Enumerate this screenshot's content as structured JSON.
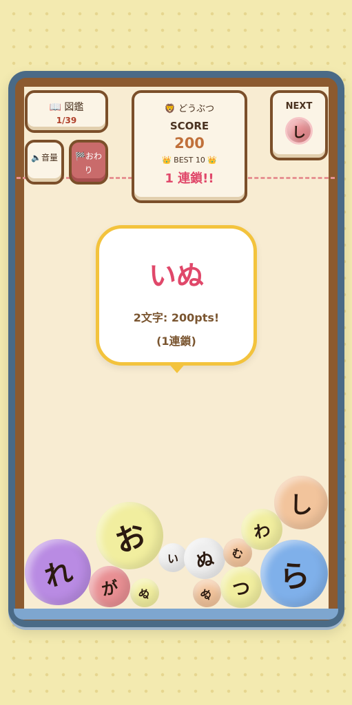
{
  "encyclopedia": {
    "icon": "book-icon",
    "label": "📖 図鑑",
    "count": "1/39"
  },
  "volume_button": {
    "icon": "speaker-icon",
    "label": "🔈音量"
  },
  "finish_button": {
    "icon": "checkered-flag-icon",
    "label": "🏁おわり"
  },
  "score_panel": {
    "category": "🦁 どうぶつ",
    "score_label": "SCORE",
    "score": "200",
    "best_label": "👑 BEST 10 👑",
    "chain": "1 連鎖!!"
  },
  "next_panel": {
    "label": "NEXT",
    "char": "し"
  },
  "popup": {
    "word": "いぬ",
    "points": "2文字: 200pts!",
    "chain": "(1連鎖)"
  },
  "colors": {
    "background": "#f3eab0",
    "frame": "#4a6a86",
    "wood": "#8c5a2f",
    "board": "#f8ecd2",
    "accent_red": "#e0486a",
    "score_orange": "#c0703a",
    "bubble_border": "#f3c33d"
  },
  "balls": [
    {
      "char": "れ",
      "color": "#b98be3"
    },
    {
      "char": "が",
      "color": "#e88f93"
    },
    {
      "char": "ぬ",
      "color": "#f1ee9f"
    },
    {
      "char": "お",
      "color": "#f1ee9f"
    },
    {
      "char": "い",
      "color": "#eeeeee"
    },
    {
      "char": "ぬ",
      "color": "#eeeeee"
    },
    {
      "char": "ぬ",
      "color": "#f2c49c"
    },
    {
      "char": "む",
      "color": "#f2c49c"
    },
    {
      "char": "つ",
      "color": "#f1ee9f"
    },
    {
      "char": "わ",
      "color": "#f1ee9f"
    },
    {
      "char": "ら",
      "color": "#7fb0ea"
    },
    {
      "char": "し",
      "color": "#f2c49c"
    }
  ]
}
